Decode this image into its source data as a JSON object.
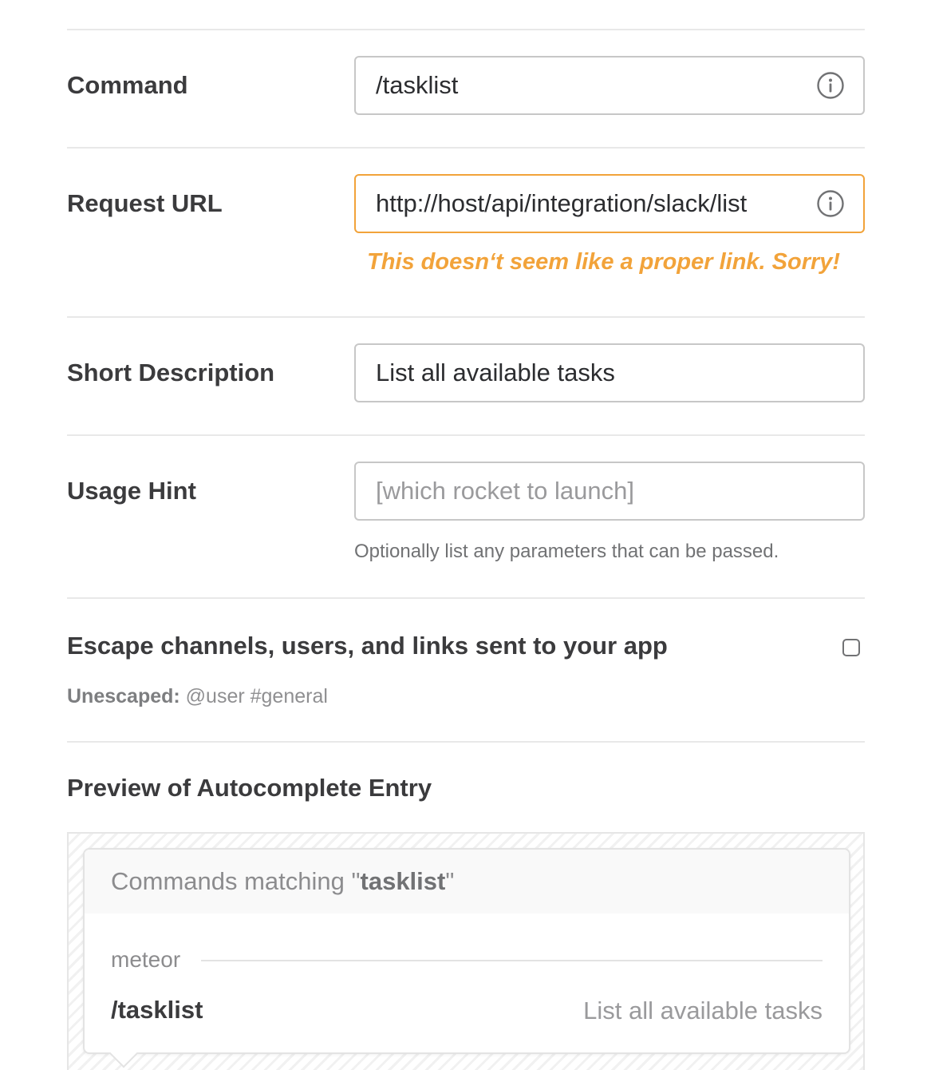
{
  "form": {
    "command": {
      "label": "Command",
      "value": "/tasklist",
      "icon": "info-icon"
    },
    "request_url": {
      "label": "Request URL",
      "value": "http://host/api/integration/slack/list",
      "icon": "info-icon",
      "error": "This doesn‘t seem like a proper link. Sorry!"
    },
    "short_description": {
      "label": "Short Description",
      "value": "List all available tasks"
    },
    "usage_hint": {
      "label": "Usage Hint",
      "placeholder": "[which rocket to launch]",
      "help": "Optionally list any parameters that can be passed."
    },
    "escape": {
      "label": "Escape channels, users, and links sent to your app",
      "checked": false,
      "unescaped_label": "Unescaped:",
      "unescaped_example": " @user #general"
    }
  },
  "preview": {
    "title": "Preview of Autocomplete Entry",
    "header_prefix": "Commands matching \"",
    "header_query": "tasklist",
    "header_suffix": "\"",
    "group": "meteor",
    "item_command": "/tasklist",
    "item_description": "List all available tasks"
  },
  "colors": {
    "warning": "#f2a33a",
    "border": "#c7c7c7",
    "label": "#3b3b3d"
  }
}
